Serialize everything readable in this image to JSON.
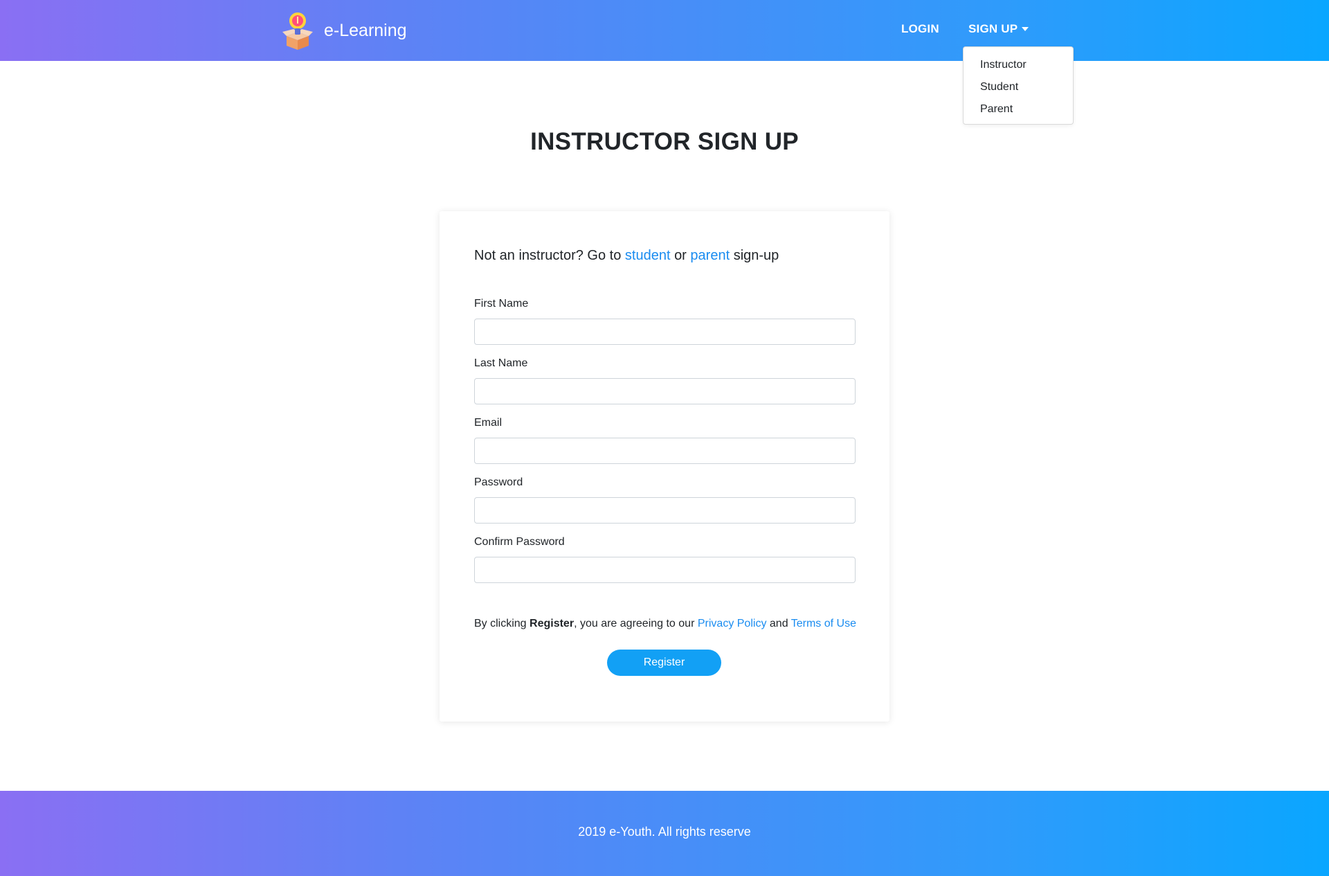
{
  "header": {
    "brand_name": "e-Learning",
    "nav": {
      "login": "LOGIN",
      "signup": "SIGN UP"
    },
    "dropdown": [
      "Instructor",
      "Student",
      "Parent"
    ]
  },
  "page_title": "INSTRUCTOR SIGN UP",
  "card": {
    "intro": {
      "prefix": "Not an instructor? Go to",
      "student_link": "student",
      "or": "or",
      "parent_link": "parent",
      "suffix": "sign-up"
    },
    "fields": [
      {
        "label": "First Name",
        "value": ""
      },
      {
        "label": "Last Name",
        "value": ""
      },
      {
        "label": "Email",
        "value": ""
      },
      {
        "label": "Password",
        "value": ""
      },
      {
        "label": "Confirm Password",
        "value": ""
      }
    ],
    "terms": {
      "prefix": "By clicking",
      "bold": "Register",
      "middle": ", you are agreeing to our",
      "privacy": "Privacy Policy",
      "and": "and",
      "terms": "Terms of Use"
    },
    "register_label": "Register"
  },
  "footer": {
    "text": "2019 e-Youth. All rights reserve"
  },
  "colors": {
    "accent": "#12a0f5",
    "link": "#1a8cf0",
    "gradient_start": "#8a6ff3",
    "gradient_end": "#0aa6ff"
  },
  "icons": {
    "logo": "lightbulb-box-logo-icon",
    "caret": "caret-down-icon"
  }
}
